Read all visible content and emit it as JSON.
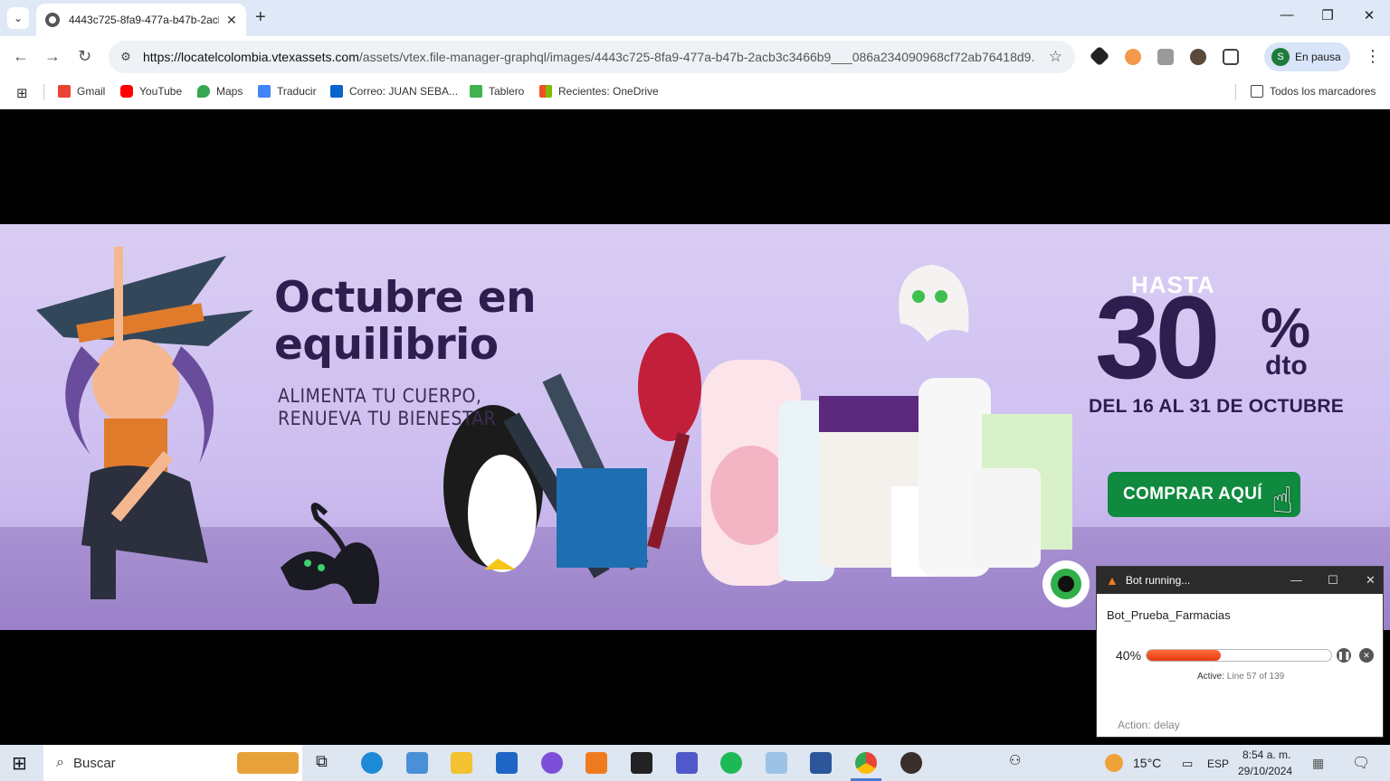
{
  "browser": {
    "tab_title": "4443c725-8fa9-477a-b47b-2acb",
    "url_host": "https://locatelcolombia.vtexassets.com",
    "url_path": "/assets/vtex.file-manager-graphql/images/4443c725-8fa9-477a-b47b-2acb3c3466b9___086a234090968cf72ab76418d9...",
    "profile_initial": "S",
    "profile_label": "En pausa",
    "bookmarks": [
      "Gmail",
      "YouTube",
      "Maps",
      "Traducir",
      "Correo: JUAN SEBA...",
      "Tablero",
      "Recientes: OneDrive"
    ],
    "all_bookmarks": "Todos los marcadores"
  },
  "banner": {
    "title_line1": "Octubre en",
    "title_line2": "equilibrio",
    "sub_line1": "ALIMENTA TU CUERPO,",
    "sub_line2": "RENUEVA TU BIENESTAR",
    "hasta": "HASTA",
    "discount": "30",
    "pct": "%",
    "dto": "dto",
    "dates": "DEL 16 AL 31 DE OCTUBRE",
    "cta": "COMPRAR AQUÍ"
  },
  "bot": {
    "title": "Bot running...",
    "name": "Bot_Prueba_Farmacias",
    "progress_label": "40%",
    "progress": 0.4,
    "active_label": "Active:",
    "active_value": "Line 57 of 139",
    "action": "Action: delay"
  },
  "taskbar": {
    "search": "Buscar",
    "temp": "15°C",
    "lang": "ESP",
    "time": "8:54 a. m.",
    "date": "29/10/2024"
  }
}
